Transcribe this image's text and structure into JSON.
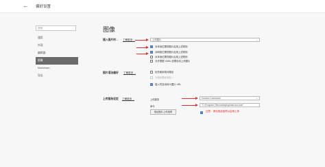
{
  "window": {
    "back_glyph": "←",
    "title": "偏好设置"
  },
  "sidebar": {
    "search_placeholder": "搜索",
    "items": [
      {
        "label": "通用",
        "active": false
      },
      {
        "label": "外观",
        "active": false
      },
      {
        "label": "编辑器",
        "active": false
      },
      {
        "label": "图像",
        "active": true
      },
      {
        "label": "Markdown",
        "active": false
      },
      {
        "label": "导出",
        "active": false
      }
    ]
  },
  "page": {
    "title": "图像"
  },
  "insert_section": {
    "label": "插入图片时…",
    "help_link": "了解更多…",
    "action_value": "上传图片",
    "options": [
      {
        "label": "对本地位置的图片应用上述规则",
        "checked": true
      },
      {
        "label": "对网络位置的图片应用上述规则",
        "checked": true
      },
      {
        "label": "对本地位置的图片应用上述规则",
        "checked": false
      },
      {
        "label": "允许根据 YAML 设置自动上传图片",
        "checked": false
      }
    ]
  },
  "syntax_section": {
    "label": "图片语法偏好",
    "help_link": "了解更多…",
    "options": [
      {
        "label": "优先使用相对路径",
        "checked": false,
        "disabled": false
      },
      {
        "label": "为相对路径添加 ./",
        "checked": false,
        "disabled": true
      },
      {
        "label": "插入时自动转义图片 URL",
        "checked": true,
        "disabled": false
      }
    ]
  },
  "upload_section": {
    "label": "上传服务设定",
    "help_link": "了解更多…",
    "service_label": "上传服务",
    "service_value": "Custom Command",
    "command_label": "命令",
    "command_value": "\"C:\\Program Files\\nodejs\\upload-tool.exe\"",
    "verify_button": "验证图片上传选项",
    "note": "注意：请勾选该选项以启用上传",
    "checked": true
  },
  "colors": {
    "accent": "#5a8bd6",
    "annotation": "#e02020",
    "nav_active": "#6b6b6b"
  }
}
